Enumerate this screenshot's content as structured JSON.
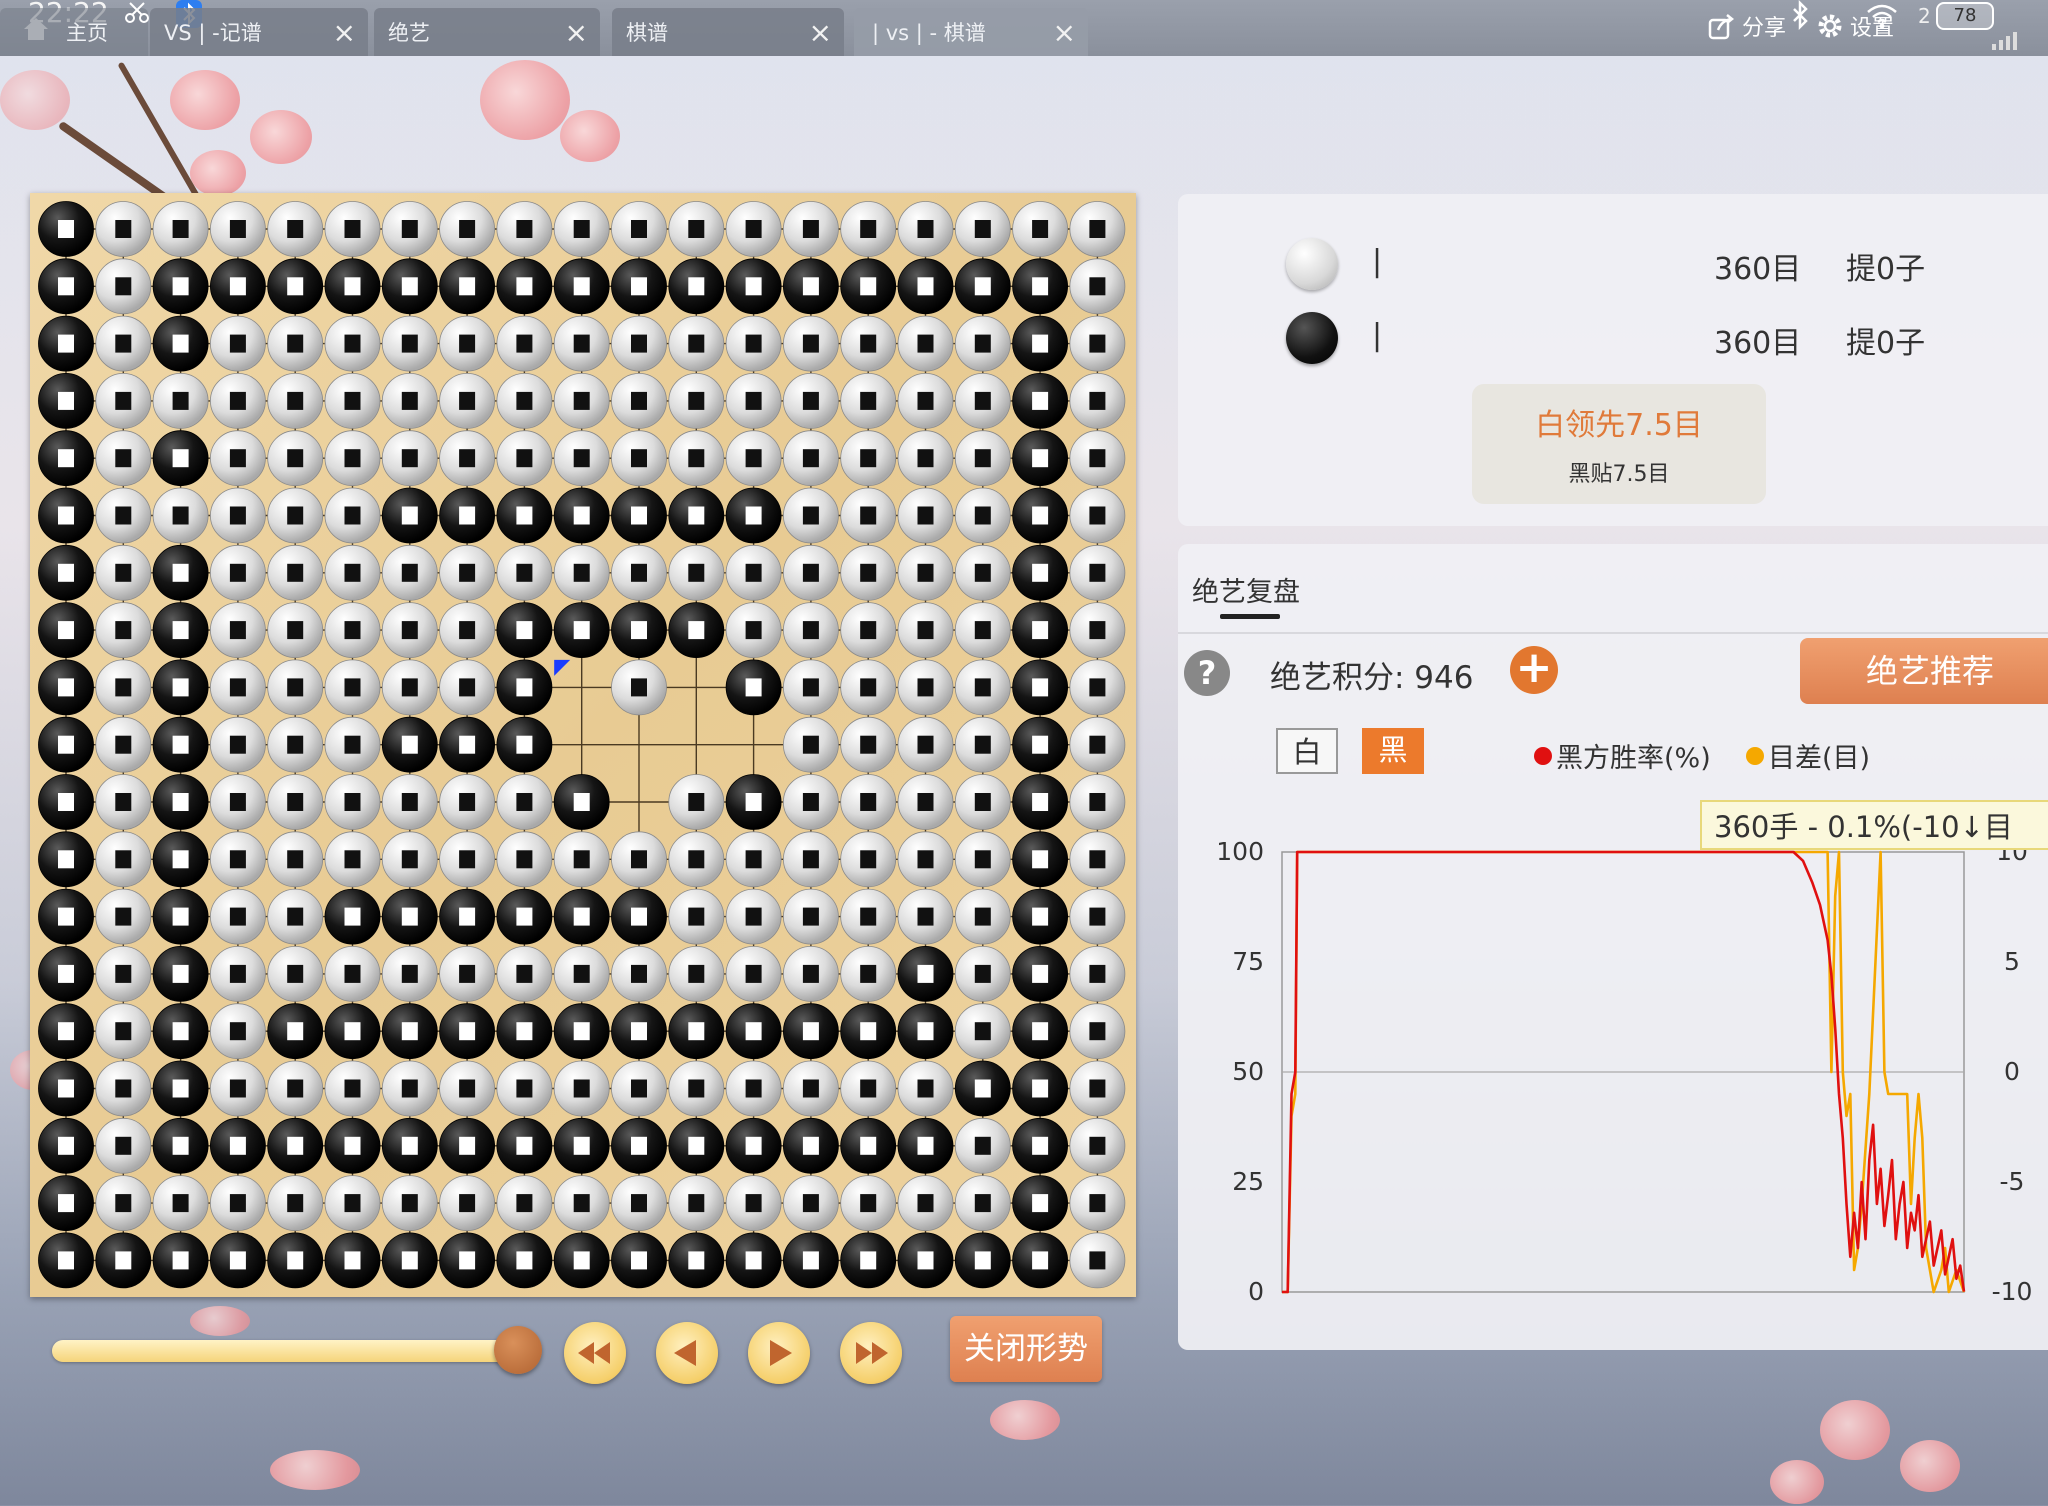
{
  "status_bar": {
    "time": "22:22",
    "battery": "78",
    "battery_prefix": "2"
  },
  "tabs": [
    {
      "label": "主页",
      "closable": false
    },
    {
      "label": "VS | -记谱",
      "closable": true
    },
    {
      "label": "绝艺",
      "closable": true
    },
    {
      "label": "棋谱",
      "closable": true
    },
    {
      "label": "| vs | - 棋谱",
      "closable": true,
      "active": true
    }
  ],
  "toolbar": {
    "share_label": "分享",
    "settings_label": "设置"
  },
  "icons": {
    "home": "home-icon",
    "share": "share-icon",
    "settings": "gear-icon",
    "wifi": "wifi-icon",
    "bluetooth": "bluetooth-icon",
    "scissors": "scissors-icon",
    "battery": "battery-icon",
    "help": "help-icon",
    "plus": "plus-icon"
  },
  "players": {
    "white": {
      "name": "|",
      "territory": "360目",
      "captures": "提0子"
    },
    "black": {
      "name": "|",
      "territory": "360目",
      "captures": "提0子"
    }
  },
  "result": {
    "lead": "白领先7.5目",
    "komi": "黑贴7.5目"
  },
  "review": {
    "tab_label": "绝艺复盘",
    "help_symbol": "?",
    "score_label": "绝艺积分: 946",
    "plus_symbol": "+",
    "recommend_label": "绝艺推荐",
    "side_white": "白",
    "side_black": "黑",
    "legend_winrate": "黑方胜率(%)",
    "legend_diff": "目差(目)",
    "tooltip": "360手 - 0.1%(-10↓目"
  },
  "controls": {
    "close_label": "关闭形势",
    "progress": 1.0
  },
  "colors": {
    "accent": "#ec7a2c",
    "winrate_line": "#e01010",
    "diff_line": "#f5a800",
    "lead_text": "#e07a3a"
  },
  "board": {
    "size": 19,
    "rows": [
      "BWWWWWWWWWWWWWWWWWW",
      "BWBBBBBBBBBBBBBBBBW",
      "BWBWWWWWWWWWWWWWWBW",
      "BWWWWWWWWWWWWWWWWBW",
      "BWBWWWWWWWWWWWWWWBW",
      "BWWWWWBBBBBBBWWWWBW",
      "BWBWWWWWWWWWWWWWWBW",
      "BWBWWWWWBBBBWWWWWBW",
      "BWBWWWWWB.W.BWWWWBW",
      "BWBWWWBBB....WWWWBW",
      "BWBWWWWWWB.WBWWWWBW",
      "BWBWWWWWWWWWWWWWWBW",
      "BWBWWBBBBBBWWWWWWBW",
      "BWBWWWWWWWWWWWWBWBW",
      "BWBWBBBBBBBBBBBBWBW",
      "BWBWWWWWWWWWWWWWBBW",
      "BWBBBBBBBBBBBBBBWBW",
      "BWWWWWWWWWWWWWWWWBW",
      "BBBBBBBBBBBBBBBBBBW"
    ],
    "last_move": [
      8,
      9
    ]
  },
  "chart_data": {
    "type": "line",
    "title": "",
    "xlabel": "",
    "ylabel": "",
    "x_range": [
      0,
      360
    ],
    "y_left_ticks": [
      0,
      25,
      50,
      75,
      100
    ],
    "y_right_ticks": [
      -10,
      -5,
      0,
      5,
      10
    ],
    "y_left_range": [
      0,
      100
    ],
    "y_right_range": [
      -10,
      10
    ],
    "series": [
      {
        "name": "黑方胜率(%)",
        "axis": "left",
        "color": "#e01010",
        "points": [
          [
            0,
            0
          ],
          [
            3,
            0
          ],
          [
            5,
            45
          ],
          [
            7,
            50
          ],
          [
            8,
            100
          ],
          [
            20,
            100
          ],
          [
            100,
            100
          ],
          [
            200,
            100
          ],
          [
            270,
            100
          ],
          [
            275,
            98
          ],
          [
            280,
            93
          ],
          [
            284,
            88
          ],
          [
            288,
            80
          ],
          [
            290,
            72
          ],
          [
            292,
            60
          ],
          [
            294,
            45
          ],
          [
            296,
            35
          ],
          [
            298,
            20
          ],
          [
            300,
            8
          ],
          [
            302,
            18
          ],
          [
            304,
            10
          ],
          [
            306,
            25
          ],
          [
            308,
            12
          ],
          [
            310,
            30
          ],
          [
            312,
            38
          ],
          [
            314,
            20
          ],
          [
            316,
            28
          ],
          [
            318,
            15
          ],
          [
            320,
            22
          ],
          [
            322,
            30
          ],
          [
            324,
            12
          ],
          [
            326,
            20
          ],
          [
            328,
            25
          ],
          [
            330,
            10
          ],
          [
            332,
            18
          ],
          [
            334,
            14
          ],
          [
            336,
            22
          ],
          [
            338,
            8
          ],
          [
            340,
            12
          ],
          [
            342,
            16
          ],
          [
            344,
            6
          ],
          [
            346,
            10
          ],
          [
            348,
            14
          ],
          [
            350,
            4
          ],
          [
            352,
            8
          ],
          [
            354,
            12
          ],
          [
            356,
            3
          ],
          [
            358,
            6
          ],
          [
            360,
            0.1
          ]
        ]
      },
      {
        "name": "目差(目)",
        "axis": "right",
        "color": "#f5a800",
        "points": [
          [
            0,
            -10
          ],
          [
            3,
            -10
          ],
          [
            5,
            -2
          ],
          [
            7,
            -1
          ],
          [
            8,
            10
          ],
          [
            20,
            10
          ],
          [
            100,
            10
          ],
          [
            200,
            10
          ],
          [
            280,
            10
          ],
          [
            286,
            10
          ],
          [
            288,
            10
          ],
          [
            290,
            0
          ],
          [
            292,
            8
          ],
          [
            294,
            10
          ],
          [
            296,
            0
          ],
          [
            298,
            -2
          ],
          [
            300,
            -1
          ],
          [
            302,
            -9
          ],
          [
            304,
            -8
          ],
          [
            306,
            -6
          ],
          [
            310,
            -1
          ],
          [
            316,
            10
          ],
          [
            318,
            0
          ],
          [
            320,
            -1
          ],
          [
            330,
            -1
          ],
          [
            332,
            -6
          ],
          [
            334,
            -3
          ],
          [
            336,
            -1
          ],
          [
            338,
            -3
          ],
          [
            340,
            -8
          ],
          [
            342,
            -9
          ],
          [
            344,
            -10
          ],
          [
            348,
            -9
          ],
          [
            350,
            -8
          ],
          [
            352,
            -10
          ],
          [
            356,
            -9
          ],
          [
            360,
            -10
          ]
        ]
      }
    ]
  }
}
